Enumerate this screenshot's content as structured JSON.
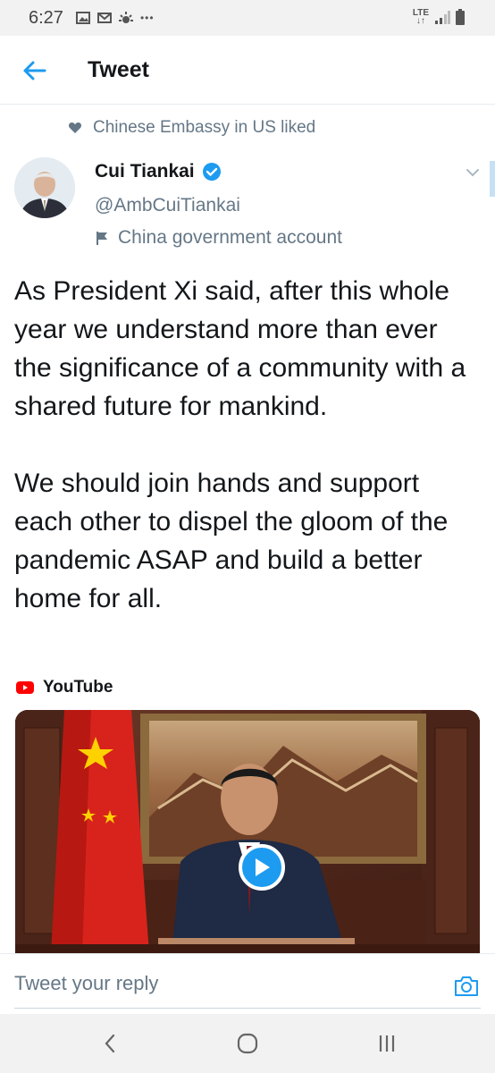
{
  "status_bar": {
    "time": "6:27",
    "dots": "•••",
    "network": "LTE"
  },
  "header": {
    "title": "Tweet",
    "back_icon": "arrow-left-icon"
  },
  "social_context": {
    "text": "Chinese Embassy in US liked",
    "icon": "heart-icon"
  },
  "tweet": {
    "author_name": "Cui Tiankai",
    "handle": "@AmbCuiTiankai",
    "label": "China government account",
    "text": "As President Xi said, after this whole year we understand more than ever the significance of a community with a shared future for mankind.\n\nWe should join hands and support each other to dispel the gloom of the pandemic ASAP and build a better home for all.",
    "card_source": "YouTube"
  },
  "reply": {
    "placeholder": "Tweet your reply"
  },
  "colors": {
    "accent": "#1d9bf0",
    "secondary_text": "#657786",
    "youtube_red": "#ff0000"
  }
}
